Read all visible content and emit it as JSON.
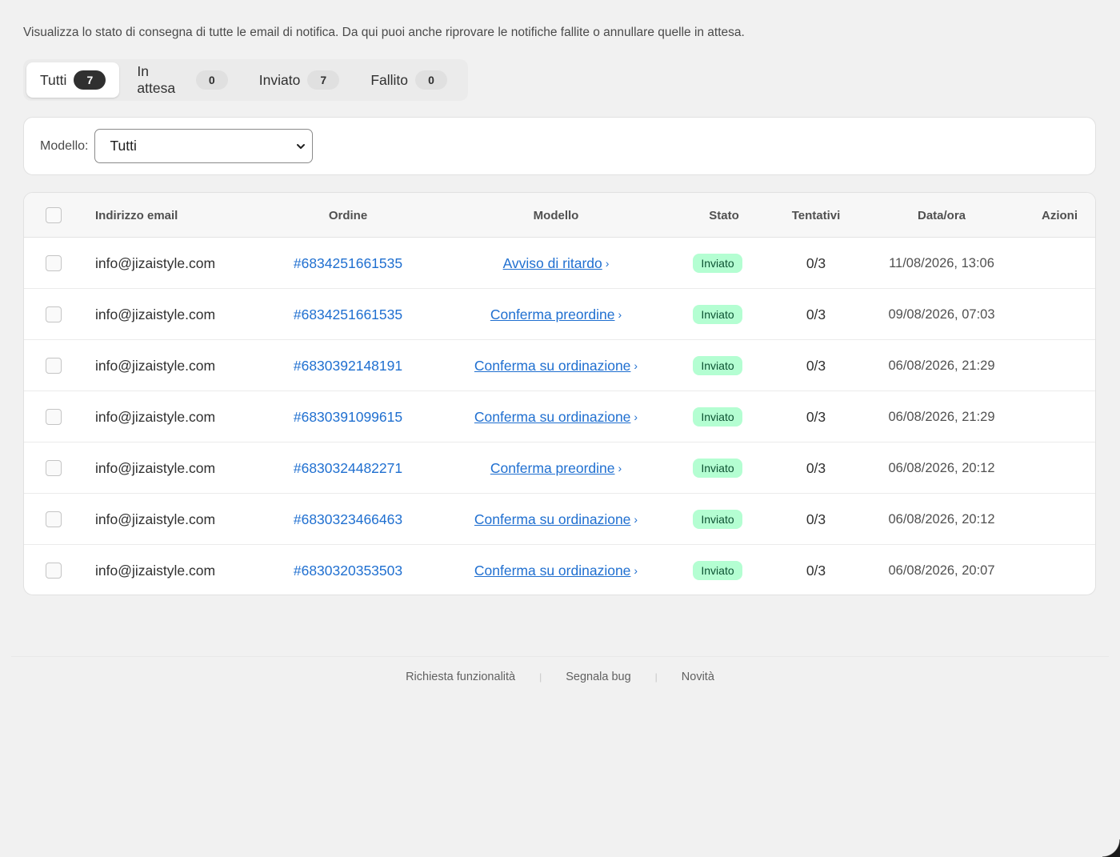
{
  "intro": "Visualizza lo stato di consegna di tutte le email di notifica. Da qui puoi anche riprovare le notifiche fallite o annullare quelle in attesa.",
  "tabs": [
    {
      "label": "Tutti",
      "count": "7"
    },
    {
      "label": "In attesa",
      "count": "0"
    },
    {
      "label": "Inviato",
      "count": "7"
    },
    {
      "label": "Fallito",
      "count": "0"
    }
  ],
  "filter": {
    "label": "Modello:",
    "selected": "Tutti"
  },
  "table": {
    "headers": {
      "email": "Indirizzo email",
      "order": "Ordine",
      "model": "Modello",
      "status": "Stato",
      "attempts": "Tentativi",
      "datetime": "Data/ora",
      "actions": "Azioni"
    },
    "rows": [
      {
        "email": "info@jizaistyle.com",
        "order": "#6834251661535",
        "model": "Avviso di ritardo",
        "status": "Inviato",
        "attempts": "0/3",
        "datetime": "11/08/2026, 13:06"
      },
      {
        "email": "info@jizaistyle.com",
        "order": "#6834251661535",
        "model": "Conferma preordine",
        "status": "Inviato",
        "attempts": "0/3",
        "datetime": "09/08/2026, 07:03"
      },
      {
        "email": "info@jizaistyle.com",
        "order": "#6830392148191",
        "model": "Conferma su ordinazione",
        "status": "Inviato",
        "attempts": "0/3",
        "datetime": "06/08/2026, 21:29"
      },
      {
        "email": "info@jizaistyle.com",
        "order": "#6830391099615",
        "model": "Conferma su ordinazione",
        "status": "Inviato",
        "attempts": "0/3",
        "datetime": "06/08/2026, 21:29"
      },
      {
        "email": "info@jizaistyle.com",
        "order": "#6830324482271",
        "model": "Conferma preordine",
        "status": "Inviato",
        "attempts": "0/3",
        "datetime": "06/08/2026, 20:12"
      },
      {
        "email": "info@jizaistyle.com",
        "order": "#6830323466463",
        "model": "Conferma su ordinazione",
        "status": "Inviato",
        "attempts": "0/3",
        "datetime": "06/08/2026, 20:12"
      },
      {
        "email": "info@jizaistyle.com",
        "order": "#6830320353503",
        "model": "Conferma su ordinazione",
        "status": "Inviato",
        "attempts": "0/3",
        "datetime": "06/08/2026, 20:07"
      }
    ]
  },
  "footer": {
    "links": [
      "Richiesta funzionalità",
      "Segnala bug",
      "Novità"
    ],
    "separator": "|"
  },
  "colors": {
    "link": "#1f6fd0",
    "status_bg": "#b4fed2",
    "status_text": "#0c5132",
    "background": "#f1f1f1"
  }
}
